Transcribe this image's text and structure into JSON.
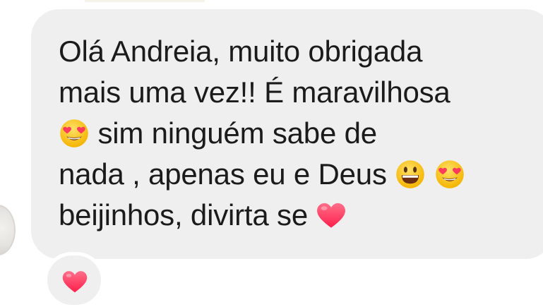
{
  "message": {
    "lines": [
      "Olá Andreia, muito obrigada",
      "mais uma vez!! É maravilhosa",
      "sim ninguém sabe de",
      "nada , apenas eu e Deus",
      "beijinhos, divirta se"
    ],
    "emojis": [
      "heart-eyes-emoji",
      "grinning-face-emoji",
      "heart-eyes-emoji",
      "red-heart-emoji"
    ]
  },
  "reaction": {
    "emoji": "red-heart-emoji"
  },
  "colors": {
    "bubble": "#efefef",
    "text": "#1b1b1b",
    "heart": "#ff2d55",
    "emoji_yellow": "#f6c12b"
  }
}
